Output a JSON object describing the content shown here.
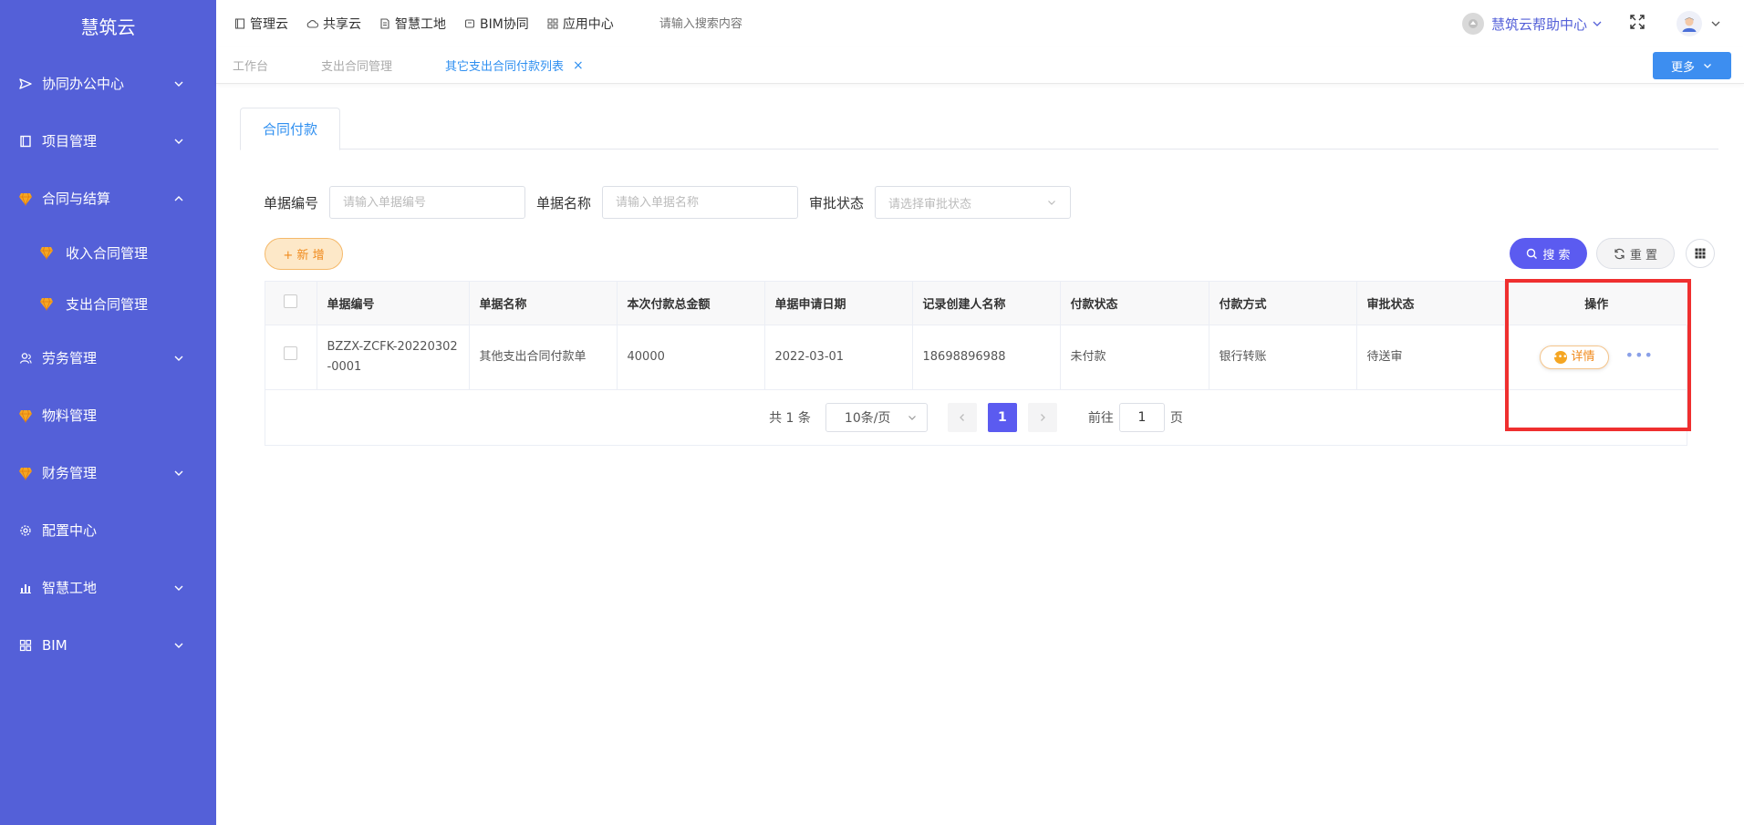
{
  "sidebar": {
    "brand": "慧筑云",
    "items": [
      {
        "label": "协同办公中心",
        "icon": "send-icon",
        "has_chevron": true,
        "expanded": false
      },
      {
        "label": "项目管理",
        "icon": "book-icon",
        "has_chevron": true,
        "expanded": false
      },
      {
        "label": "合同与结算",
        "icon": "diamond-icon",
        "has_chevron": true,
        "expanded": true
      },
      {
        "label": "劳务管理",
        "icon": "user-group-icon",
        "has_chevron": true,
        "expanded": false
      },
      {
        "label": "物料管理",
        "icon": "diamond-icon",
        "has_chevron": false,
        "expanded": false
      },
      {
        "label": "财务管理",
        "icon": "diamond-icon",
        "has_chevron": true,
        "expanded": false
      },
      {
        "label": "配置中心",
        "icon": "gear-icon",
        "has_chevron": false,
        "expanded": false
      },
      {
        "label": "智慧工地",
        "icon": "bar-chart-icon",
        "has_chevron": true,
        "expanded": false
      },
      {
        "label": "BIM",
        "icon": "grid-icon",
        "has_chevron": true,
        "expanded": false
      }
    ],
    "subitems": [
      {
        "label": "收入合同管理",
        "icon": "diamond-icon"
      },
      {
        "label": "支出合同管理",
        "icon": "diamond-icon"
      }
    ]
  },
  "topbar": {
    "nav": [
      {
        "label": "管理云",
        "icon": "book-icon"
      },
      {
        "label": "共享云",
        "icon": "cloud-icon"
      },
      {
        "label": "智慧工地",
        "icon": "document-icon"
      },
      {
        "label": "BIM协同",
        "icon": "cube-icon"
      },
      {
        "label": "应用中心",
        "icon": "grid-icon"
      }
    ],
    "search_placeholder": "请输入搜索内容",
    "help_label": "慧筑云帮助中心"
  },
  "tabs": [
    {
      "label": "工作台",
      "active": false
    },
    {
      "label": "支出合同管理",
      "active": false
    },
    {
      "label": "其它支出合同付款列表",
      "active": true
    }
  ],
  "more_label": "更多",
  "card_tab_label": "合同付款",
  "filters": {
    "bill_no_label": "单据编号",
    "bill_no_placeholder": "请输入单据编号",
    "bill_name_label": "单据名称",
    "bill_name_placeholder": "请输入单据名称",
    "status_label": "审批状态",
    "status_placeholder": "请选择审批状态"
  },
  "buttons": {
    "add": "+ 新 增",
    "search": "搜 索",
    "reset": "重 置"
  },
  "table": {
    "columns": [
      "单据编号",
      "单据名称",
      "本次付款总金额",
      "单据申请日期",
      "记录创建人名称",
      "付款状态",
      "付款方式",
      "审批状态",
      "操作"
    ],
    "rows": [
      {
        "bill_no": "BZZX-ZCFK-20220302-0001",
        "bill_name": "其他支出合同付款单",
        "amount": "40000",
        "date": "2022-03-01",
        "creator": "18698896988",
        "pay_status": "未付款",
        "pay_method": "银行转账",
        "approval_status": "待送审",
        "action_label": "详情"
      }
    ]
  },
  "pagination": {
    "total": "共 1 条",
    "page_size": "10条/页",
    "current_page": "1",
    "goto_label": "前往",
    "goto_value": "1",
    "page_unit": "页"
  },
  "colors": {
    "sidebar_bg": "#5460d8",
    "accent": "#2f8ff0",
    "primary_button": "#5b5bf0",
    "highlight": "#ef2f2f"
  }
}
